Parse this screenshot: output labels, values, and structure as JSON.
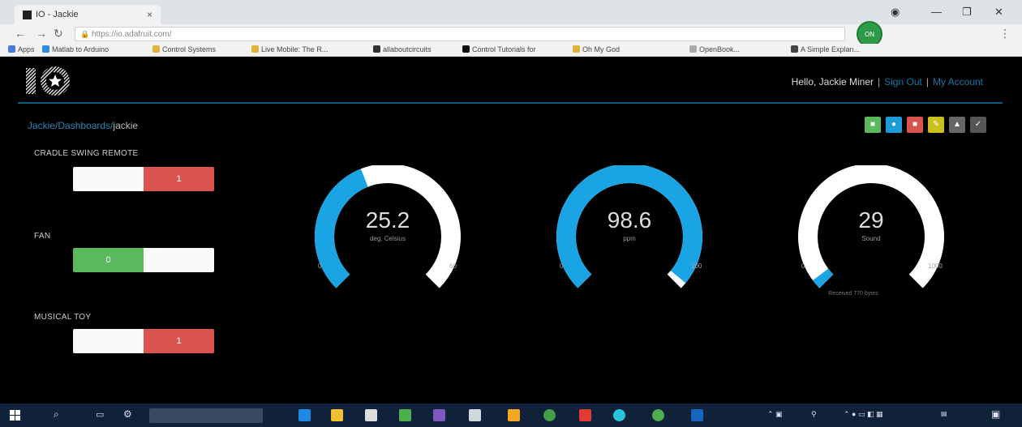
{
  "browser": {
    "tab_title": "IO - Jackie",
    "url": "https://io.adafruit.com/",
    "bookmarks": [
      "Apps",
      "Matlab to Arduino",
      "Control Systems",
      "Live Mobile: The R...",
      "allaboutcircuits",
      "Control Tutorials for",
      "Oh My God",
      "OpenBook...",
      "A Simple Explan..."
    ]
  },
  "header": {
    "greeting": "Hello, Jackie Miner",
    "sign_out": "Sign Out",
    "my_account": "My Account"
  },
  "breadcrumb": {
    "user": "Jackie",
    "dashboards": "Dashboards",
    "current": "jackie",
    "sep": "/"
  },
  "toolbar": [
    {
      "name": "add-block",
      "color": "#5cb85c",
      "icon": "plus-icon"
    },
    {
      "name": "settings",
      "color": "#1e9bd7",
      "icon": "gear-icon"
    },
    {
      "name": "delete",
      "color": "#d9534f",
      "icon": "trash-icon"
    },
    {
      "name": "edit",
      "color": "#c9c020",
      "icon": "pencil-icon"
    },
    {
      "name": "lock",
      "color": "#666666",
      "icon": "lock-icon"
    },
    {
      "name": "check",
      "color": "#555555",
      "icon": "check-icon"
    }
  ],
  "toggles": [
    {
      "label": "CRADLE SWING REMOTE",
      "value": "1",
      "state": "on"
    },
    {
      "label": "FAN",
      "value": "0",
      "state": "off"
    },
    {
      "label": "MUSICAL TOY",
      "value": "1",
      "state": "on"
    }
  ],
  "gauges": [
    {
      "value": "25.2",
      "unit": "deg. Celsius",
      "min": "0",
      "max": "60",
      "fraction": 0.42
    },
    {
      "value": "98.6",
      "unit": "ppm",
      "min": "0",
      "max": "100",
      "fraction": 0.98
    },
    {
      "value": "29",
      "unit": "Sound",
      "min": "0",
      "max": "1000",
      "fraction": 0.03
    }
  ],
  "gauge_footnote": "Received 770 bytes",
  "colors": {
    "accent": "#1ba4e4",
    "on": "#d9534f",
    "off": "#5cb85c"
  }
}
